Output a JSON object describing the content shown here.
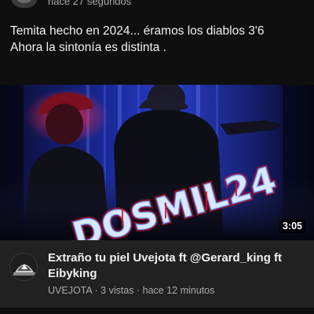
{
  "header": {
    "time_text": "hace 27 segundos",
    "avatar_icon": "channel-avatar-icon"
  },
  "post": {
    "line1": "Temita hecho en 2024... éramos los diablos 3'6",
    "line2": "Ahora la sintonía es distinta ."
  },
  "thumbnail": {
    "overlay_text": "DOSMIL24",
    "duration": "3:05"
  },
  "video": {
    "title": "Extraño tu piel  Uvejota ft @Gerard_king ft Eibyking",
    "channel": "UVEJOTA",
    "separator": " · ",
    "views": "3 vistas",
    "time": "hace 12 minutos"
  },
  "colors": {
    "background": "#0f0f0f",
    "card": "#212121",
    "secondary_text": "#aaaaaa",
    "neon_text": "#d8e8ff",
    "neon_red": "#e0102a"
  }
}
